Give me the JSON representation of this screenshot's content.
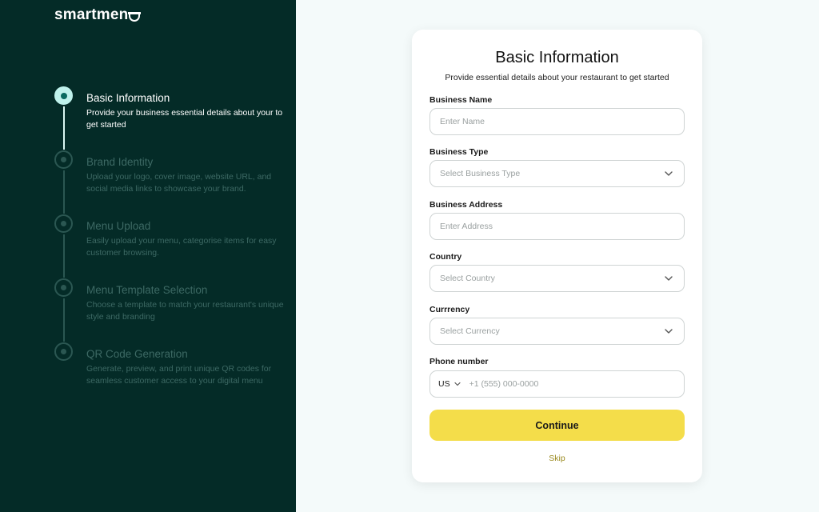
{
  "brand": {
    "logo_text": "smartmen"
  },
  "steps": [
    {
      "title": "Basic Information",
      "desc": "Provide your business  essential details about your to get started",
      "active": true
    },
    {
      "title": "Brand Identity",
      "desc": "Upload your logo, cover image, website URL, and social media links to showcase your brand.",
      "active": false
    },
    {
      "title": "Menu Upload",
      "desc": "Easily upload your menu, categorise items for easy customer browsing.",
      "active": false
    },
    {
      "title": "Menu Template Selection",
      "desc": "Choose a template to match your restaurant's unique style and branding",
      "active": false
    },
    {
      "title": "QR Code Generation",
      "desc": "Generate, preview, and print unique QR codes for seamless customer access to your digital menu",
      "active": false
    }
  ],
  "form": {
    "title": "Basic Information",
    "subtitle": "Provide essential details about your restaurant to get started",
    "business_name": {
      "label": "Business Name",
      "placeholder": "Enter Name",
      "value": ""
    },
    "business_type": {
      "label": "Business Type",
      "placeholder": "Select Business Type"
    },
    "business_address": {
      "label": "Business Address",
      "placeholder": "Enter Address",
      "value": ""
    },
    "country": {
      "label": "Country",
      "placeholder": "Select Country"
    },
    "currency": {
      "label": "Currrency",
      "placeholder": "Select Currency"
    },
    "phone": {
      "label": "Phone number",
      "country_code": "US",
      "placeholder": "+1 (555) 000-0000",
      "value": ""
    },
    "continue_label": "Continue",
    "skip_label": "Skip"
  },
  "colors": {
    "sidebar_bg": "#042b27",
    "accent_button": "#f4dd4a",
    "skip_link": "#9b8a20",
    "active_step_dot": "#bff2ec"
  },
  "icons": {
    "select_indicator": "chevron-down-icon",
    "step_marker": "step-circle-icon"
  }
}
